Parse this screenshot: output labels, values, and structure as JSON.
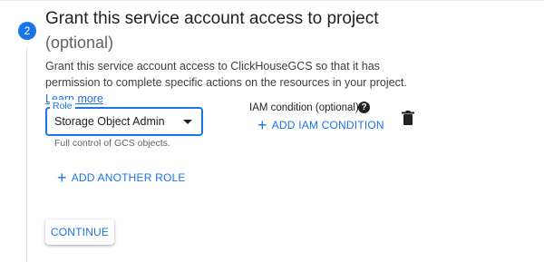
{
  "step": {
    "number": "2",
    "title": "Grant this service account access to project",
    "subtitle": "(optional)",
    "description_prefix": "Grant this service account access to ClickHouseGCS so that it has permission to complete specific actions on the resources in your project.",
    "learn_more": "Learn more"
  },
  "role_field": {
    "label": "Role",
    "value": "Storage Object Admin",
    "helper": "Full control of GCS objects."
  },
  "iam_condition": {
    "label": "IAM condition (optional)",
    "add_label": "ADD IAM CONDITION"
  },
  "actions": {
    "add_role_label": "ADD ANOTHER ROLE",
    "continue_label": "CONTINUE"
  },
  "icons": {
    "help": "help-icon",
    "delete": "trash-icon",
    "add": "plus-icon",
    "dropdown": "chevron-down-icon"
  },
  "colors": {
    "accent": "#1a73e8",
    "text": "#202124",
    "muted": "#5f6368"
  }
}
